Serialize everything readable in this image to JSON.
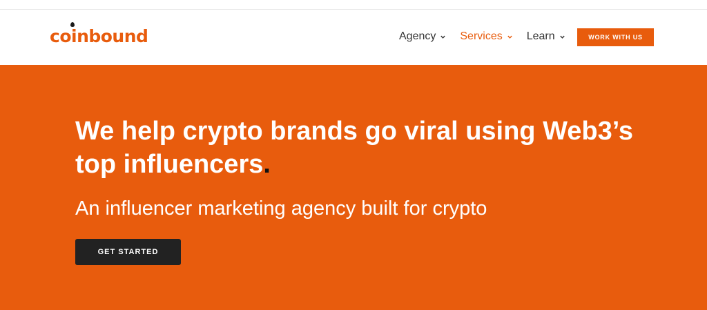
{
  "brand": {
    "logo_text": "coinbound",
    "accent_color": "#e85c0d",
    "dark_color": "#222222"
  },
  "nav": {
    "items": [
      {
        "label": "Agency",
        "icon": "chevron-down-icon",
        "active": false
      },
      {
        "label": "Services",
        "icon": "chevron-down-icon",
        "active": true
      },
      {
        "label": "Learn",
        "icon": "chevron-down-icon",
        "active": false
      }
    ],
    "cta_label": "WORK WITH US"
  },
  "hero": {
    "title": "We help crypto brands go viral using Web3’s top influencers",
    "title_period": ".",
    "subtitle": "An influencer marketing agency built for crypto",
    "button_label": "GET STARTED"
  }
}
